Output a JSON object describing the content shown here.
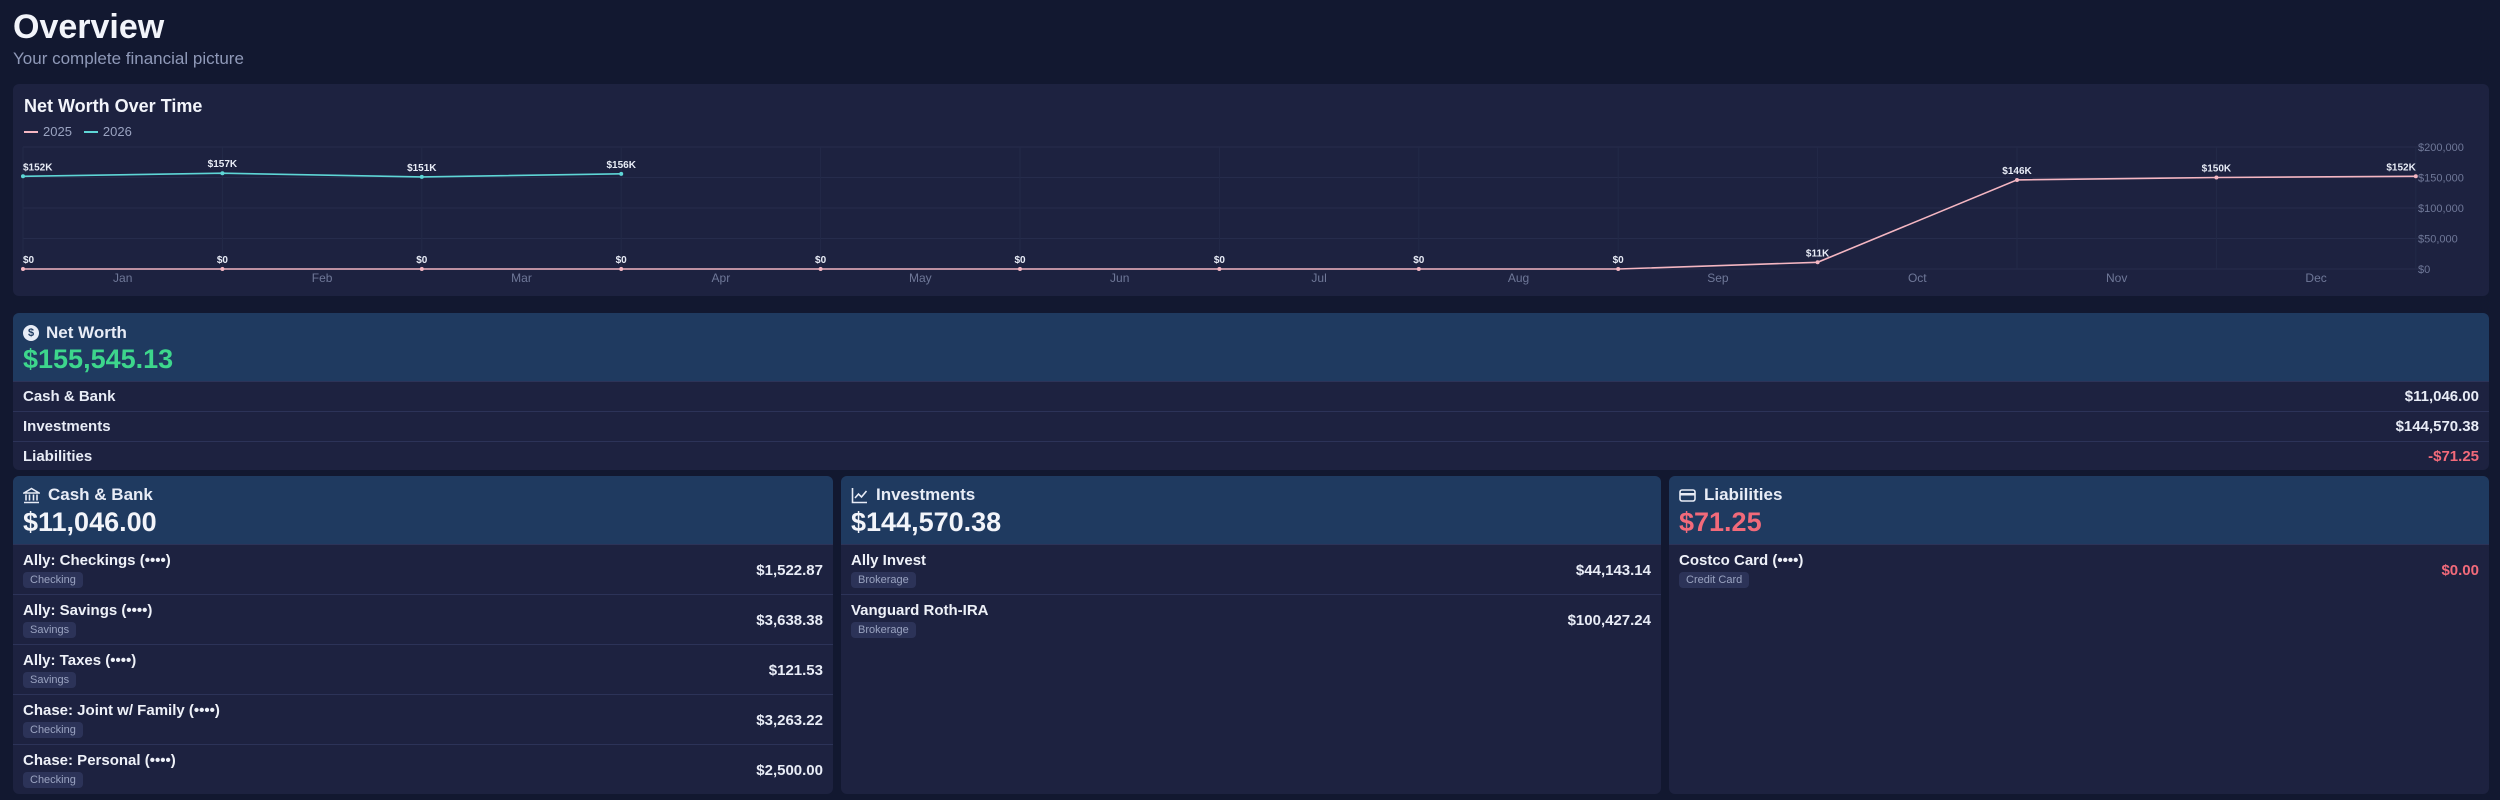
{
  "page": {
    "title": "Overview",
    "subtitle": "Your complete financial picture"
  },
  "chart_card": {
    "title": "Net Worth Over Time"
  },
  "chart_data": {
    "type": "line",
    "categories": [
      "Jan",
      "Feb",
      "Mar",
      "Apr",
      "May",
      "Jun",
      "Jul",
      "Aug",
      "Sep",
      "Oct",
      "Nov",
      "Dec"
    ],
    "series": [
      {
        "name": "2025",
        "color": "#f4b6c2",
        "values": [
          0,
          0,
          0,
          0,
          0,
          0,
          0,
          0,
          0,
          11046,
          146000,
          150000,
          152000
        ],
        "labels": [
          "$0",
          "$0",
          "$0",
          "$0",
          "$0",
          "$0",
          "$0",
          "$0",
          "$0",
          "$11K",
          "$146K",
          "$150K",
          "$152K"
        ]
      },
      {
        "name": "2026",
        "color": "#5ed6d6",
        "values": [
          152000,
          157000,
          151000,
          156000
        ],
        "labels": [
          "$152K",
          "$157K",
          "$151K",
          "$156K"
        ]
      }
    ],
    "y_ticks": [
      "$0",
      "$50,000",
      "$100,000",
      "$150,000",
      "$200,000"
    ],
    "ylim": [
      0,
      200000
    ],
    "grid": true,
    "legend": "top-left"
  },
  "net_worth": {
    "label": "Net Worth",
    "icon": "dollar-circle-icon",
    "value": "$155,545.13",
    "rows": [
      {
        "label": "Cash & Bank",
        "value": "$11,046.00"
      },
      {
        "label": "Investments",
        "value": "$144,570.38"
      },
      {
        "label": "Liabilities",
        "value": "-$71.25"
      }
    ]
  },
  "cash": {
    "label": "Cash & Bank",
    "icon": "bank-icon",
    "value": "$11,046.00",
    "accounts": [
      {
        "name": "Ally: Checkings (••••)",
        "type": "Checking",
        "amount": "$1,522.87"
      },
      {
        "name": "Ally: Savings (••••)",
        "type": "Savings",
        "amount": "$3,638.38"
      },
      {
        "name": "Ally: Taxes (••••)",
        "type": "Savings",
        "amount": "$121.53"
      },
      {
        "name": "Chase: Joint w/ Family (••••)",
        "type": "Checking",
        "amount": "$3,263.22"
      },
      {
        "name": "Chase: Personal (••••)",
        "type": "Checking",
        "amount": "$2,500.00"
      }
    ]
  },
  "investments": {
    "label": "Investments",
    "icon": "trend-chart-icon",
    "value": "$144,570.38",
    "accounts": [
      {
        "name": "Ally Invest",
        "type": "Brokerage",
        "amount": "$44,143.14"
      },
      {
        "name": "Vanguard Roth-IRA",
        "type": "Brokerage",
        "amount": "$100,427.24"
      }
    ]
  },
  "liabilities": {
    "label": "Liabilities",
    "icon": "credit-card-icon",
    "value": "$71.25",
    "accounts": [
      {
        "name": "Costco Card (••••)",
        "type": "Credit Card",
        "amount": "$0.00"
      }
    ]
  },
  "colors": {
    "positive": "#3dd68c",
    "negative": "#f26a7a",
    "header_bg": "#1f3a60"
  }
}
